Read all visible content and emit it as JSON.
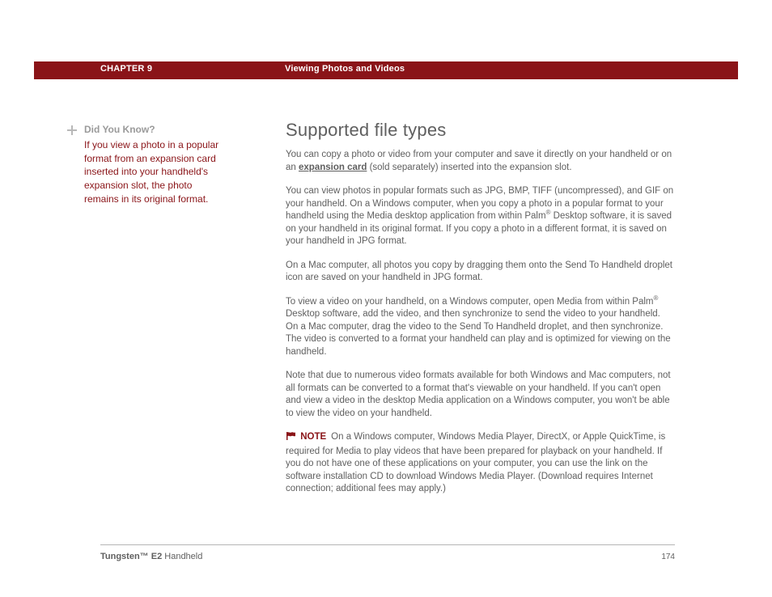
{
  "header": {
    "chapter": "CHAPTER 9",
    "title": "Viewing Photos and Videos"
  },
  "sidebar": {
    "dyk_title": "Did You Know?",
    "dyk_body": "If you view a photo in a popular format from an expansion card inserted into your handheld's expansion slot, the photo remains in its original format."
  },
  "section": {
    "title": "Supported file types",
    "intro_pre": "You can copy a photo or video from your computer and save it directly on your handheld or on an ",
    "intro_link": "expansion card",
    "intro_post": " (sold separately) inserted into the expansion slot.",
    "p2a": "You can view photos in popular formats such as JPG, BMP, TIFF (uncompressed), and GIF on your handheld. On a Windows computer, when you copy a photo in a popular format to your handheld using the Media desktop application from within Palm",
    "p2b": " Desktop software, it is saved on your handheld in its original format. If you copy a photo in a different format, it is saved on your handheld in JPG format.",
    "p3": "On a Mac computer, all photos you copy by dragging them onto the Send To Handheld droplet icon are saved on your handheld in JPG format.",
    "p4a": "To view a video on your handheld, on a Windows computer, open Media from within Palm",
    "p4b": " Desktop software, add the video, and then synchronize to send the video to your handheld. On a Mac computer, drag the video to the Send To Handheld droplet, and then synchronize. The video is converted to a format your handheld can play and is optimized for viewing on the handheld.",
    "p5": "Note that due to numerous video formats available for both Windows and Mac computers, not all formats can be converted to a format that's viewable on your handheld. If you can't open and view a video in the desktop Media application on a Windows computer, you won't be able to view the video on your handheld.",
    "note_label": "NOTE",
    "note_body": "On a Windows computer, Windows Media Player, DirectX, or Apple QuickTime, is required for Media to play videos that have been prepared for playback on your handheld. If you do not have one of these applications on your computer, you can use the link on the software installation CD to download Windows Media Player. (Download requires Internet connection; additional fees may apply.)"
  },
  "footer": {
    "product_bold": "Tungsten™ E2",
    "product_rest": " Handheld",
    "page": "174"
  },
  "reg_mark": "®"
}
